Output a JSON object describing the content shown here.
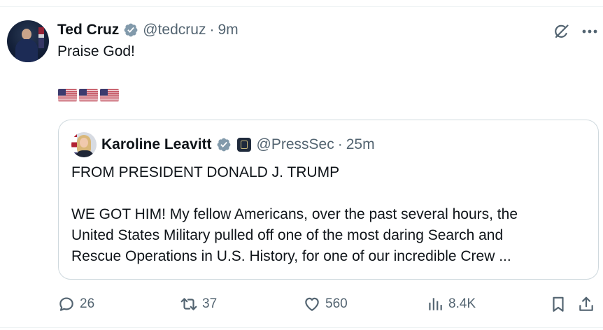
{
  "tweet": {
    "author": {
      "name": "Ted Cruz",
      "handle": "@tedcruz",
      "time": "9m",
      "verified_color": "#829aab"
    },
    "text": "Praise God!",
    "flags": [
      "us-flag",
      "us-flag",
      "us-flag"
    ],
    "quote": {
      "author": {
        "name": "Karoline Leavitt",
        "handle": "@PressSec",
        "time": "25m"
      },
      "lines": [
        "FROM PRESIDENT DONALD J. TRUMP",
        "WE GOT HIM! My fellow Americans, over the past several hours, the",
        "United States Military pulled off one of the most daring Search and",
        "Rescue Operations in U.S. History, for one of our incredible Crew ..."
      ]
    },
    "actions": {
      "replies": "26",
      "reposts": "37",
      "likes": "560",
      "views": "8.4K"
    }
  },
  "separator": "·",
  "colors": {
    "text": "#0f1419",
    "secondary": "#536471",
    "border": "#cfd9de",
    "verified_badge": "#829aab"
  },
  "icons": {
    "grok": "grok-icon",
    "more": "more-icon",
    "reply": "reply-icon",
    "repost": "repost-icon",
    "like": "heart-icon",
    "views": "views-icon",
    "bookmark": "bookmark-icon",
    "share": "share-icon"
  }
}
